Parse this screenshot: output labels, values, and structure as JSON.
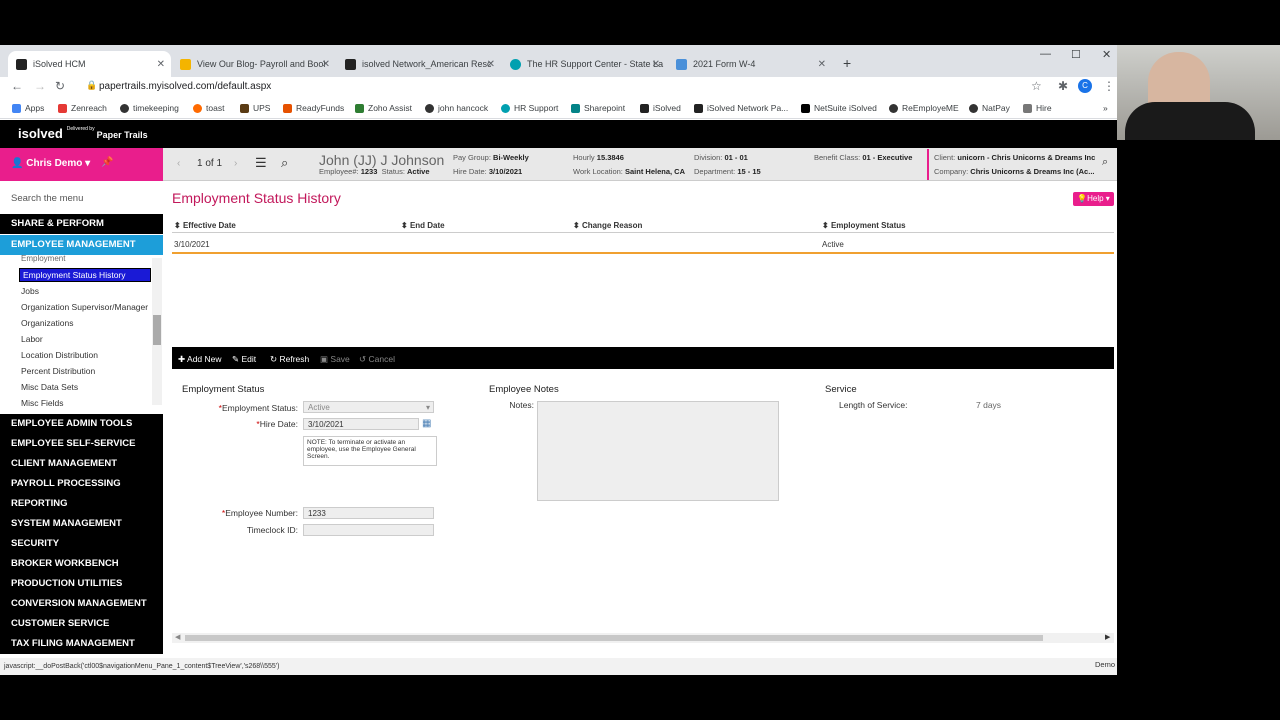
{
  "browser": {
    "tabs": [
      {
        "label": "iSolved HCM",
        "color": "#222"
      },
      {
        "label": "View Our Blog- Payroll and Bool",
        "color": "#f4b400"
      },
      {
        "label": "isolved Network_American Resc",
        "color": "#222"
      },
      {
        "label": "The HR Support Center - State La",
        "color": "#00a0b0"
      },
      {
        "label": "2021 Form W-4",
        "color": "#4a90d9"
      }
    ],
    "url": "papertrails.myisolved.com/default.aspx",
    "bookmarks": [
      "Apps",
      "Zenreach",
      "timekeeping",
      "toast",
      "UPS",
      "ReadyFunds",
      "Zoho Assist",
      "john hancock",
      "HR Support",
      "Sharepoint",
      "iSolved",
      "iSolved Network Pa...",
      "NetSuite iSolved",
      "ReEmployeME",
      "NatPay",
      "Hire"
    ],
    "status_text": "javascript:__doPostBack('ctl00$navigationMenu_Pane_1_content$TreeView','s268\\\\555')"
  },
  "app": {
    "logo": "isolved",
    "logo_sub": "Delivered by",
    "logo_partner": "Paper Trails",
    "user": "Chris Demo",
    "search_placeholder": "Search the menu",
    "menu_top": [
      "SHARE & PERFORM",
      "EMPLOYEE MANAGEMENT"
    ],
    "submenu": [
      "Employment",
      "Employment Status History",
      "Jobs",
      "Organization Supervisor/Manager",
      "Organizations",
      "Labor",
      "Location Distribution",
      "Percent Distribution",
      "Misc Data Sets",
      "Misc Fields"
    ],
    "menu_bottom": [
      "EMPLOYEE ADMIN TOOLS",
      "EMPLOYEE SELF-SERVICE",
      "CLIENT MANAGEMENT",
      "PAYROLL PROCESSING",
      "REPORTING",
      "SYSTEM MANAGEMENT",
      "SECURITY",
      "BROKER WORKBENCH",
      "PRODUCTION UTILITIES",
      "CONVERSION MANAGEMENT",
      "CUSTOMER SERVICE",
      "TAX FILING MANAGEMENT"
    ],
    "footer_demo": "Demo"
  },
  "header": {
    "pager": "1 of 1",
    "employee_name": "John (JJ) J Johnson",
    "employee_num_label": "Employee#:",
    "employee_num": "1233",
    "status_label": "Status:",
    "status": "Active",
    "pay_group_label": "Pay Group:",
    "pay_group": "Bi-Weekly",
    "hire_date_label": "Hire Date:",
    "hire_date": "3/10/2021",
    "hourly_label": "Hourly",
    "hourly": "15.3846",
    "work_loc_label": "Work Location:",
    "work_loc": "Saint Helena, CA",
    "division_label": "Division:",
    "division": "01 - 01",
    "department_label": "Department:",
    "department": "15 - 15",
    "benefit_label": "Benefit Class:",
    "benefit": "01 - Executive",
    "client_label": "Client:",
    "client": "unicorn - Chris Unicorns & Dreams Inc",
    "company_label": "Company:",
    "company": "Chris Unicorns & Dreams Inc (Ac..."
  },
  "page": {
    "title": "Employment Status History",
    "help": "Help",
    "columns": [
      "Effective Date",
      "End Date",
      "Change Reason",
      "Employment Status"
    ],
    "rows": [
      {
        "effective": "3/10/2021",
        "end": "",
        "reason": "",
        "status": "Active"
      }
    ],
    "toolbar": {
      "add": "Add New",
      "edit": "Edit",
      "refresh": "Refresh",
      "save": "Save",
      "cancel": "Cancel"
    },
    "form": {
      "section_status": "Employment Status",
      "section_notes": "Employee Notes",
      "section_service": "Service",
      "status_label": "Employment Status:",
      "status_value": "Active",
      "hire_label": "Hire Date:",
      "hire_value": "3/10/2021",
      "note_text": "NOTE: To terminate or activate an employee, use the Employee General Screen.",
      "notes_label": "Notes:",
      "los_label": "Length of Service:",
      "los_value": "7 days",
      "empnum_label": "Employee Number:",
      "empnum_value": "1233",
      "timeclock_label": "Timeclock ID:",
      "timeclock_value": ""
    }
  }
}
